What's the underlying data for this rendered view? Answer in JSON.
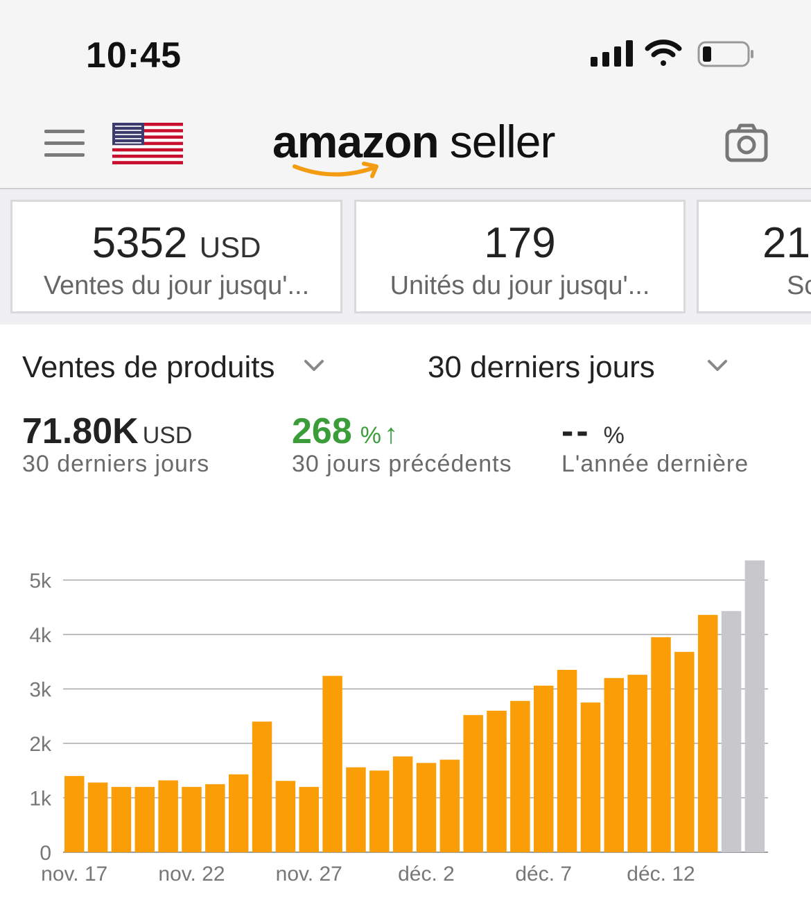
{
  "status_bar": {
    "time": "10:45",
    "icons": [
      "signal-icon",
      "wifi-icon",
      "battery-icon"
    ]
  },
  "header": {
    "logo_amazon": "amazon",
    "logo_seller": "seller",
    "icons": [
      "hamburger-menu-icon",
      "us-flag-icon",
      "camera-icon"
    ],
    "accent_color": "#f39c12"
  },
  "tiles": [
    {
      "value": "5352",
      "unit": "USD",
      "label": "Ventes du jour jusqu'..."
    },
    {
      "value": "179",
      "unit": "",
      "label": "Unités du jour jusqu'..."
    },
    {
      "value": "21.",
      "unit": "",
      "label": "Sc"
    }
  ],
  "selectors": {
    "metric": "Ventes de produits",
    "period": "30 derniers jours"
  },
  "metrics": {
    "total": {
      "value": "71.80K",
      "unit": "USD",
      "label": "30 derniers jours"
    },
    "previous": {
      "value": "268",
      "unit": "%",
      "arrow": "↑",
      "label": "30 jours précédents",
      "color": "#3a9d3a"
    },
    "last_year": {
      "value": "--",
      "unit": "%",
      "label": "L'année dernière"
    }
  },
  "chart_data": {
    "type": "bar",
    "y_ticks": [
      "0",
      "1k",
      "2k",
      "3k",
      "4k",
      "5k"
    ],
    "ylim": [
      0,
      5400
    ],
    "x_tick_labels": [
      "nov. 17",
      "nov. 22",
      "nov. 27",
      "déc. 2",
      "déc. 7",
      "déc. 12"
    ],
    "x_tick_positions": [
      0,
      5,
      10,
      15,
      20,
      25
    ],
    "categories": [
      "nov. 17",
      "nov. 18",
      "nov. 19",
      "nov. 20",
      "nov. 21",
      "nov. 22",
      "nov. 23",
      "nov. 24",
      "nov. 25",
      "nov. 26",
      "nov. 27",
      "nov. 28",
      "nov. 29",
      "nov. 30",
      "déc. 1",
      "déc. 2",
      "déc. 3",
      "déc. 4",
      "déc. 5",
      "déc. 6",
      "déc. 7",
      "déc. 8",
      "déc. 9",
      "déc. 10",
      "déc. 11",
      "déc. 12",
      "déc. 13",
      "déc. 14",
      "déc. 15",
      "déc. 16",
      "déc. 17"
    ],
    "values": [
      1400,
      1280,
      1200,
      1200,
      1320,
      1200,
      1250,
      1430,
      2400,
      1310,
      1200,
      3240,
      1560,
      1500,
      1760,
      1640,
      1700,
      2520,
      2600,
      2780,
      3060,
      3350,
      2750,
      3200,
      3260,
      3950,
      3680,
      4360,
      4430,
      5360,
      0
    ],
    "series_colors": [
      "#fb9d06",
      "#fb9d06",
      "#fb9d06",
      "#fb9d06",
      "#fb9d06",
      "#fb9d06",
      "#fb9d06",
      "#fb9d06",
      "#fb9d06",
      "#fb9d06",
      "#fb9d06",
      "#fb9d06",
      "#fb9d06",
      "#fb9d06",
      "#fb9d06",
      "#fb9d06",
      "#fb9d06",
      "#fb9d06",
      "#fb9d06",
      "#fb9d06",
      "#fb9d06",
      "#fb9d06",
      "#fb9d06",
      "#fb9d06",
      "#fb9d06",
      "#fb9d06",
      "#fb9d06",
      "#fb9d06",
      "#c7c7cc",
      "#c7c7cc",
      "#c7c7cc"
    ],
    "grid": true
  }
}
